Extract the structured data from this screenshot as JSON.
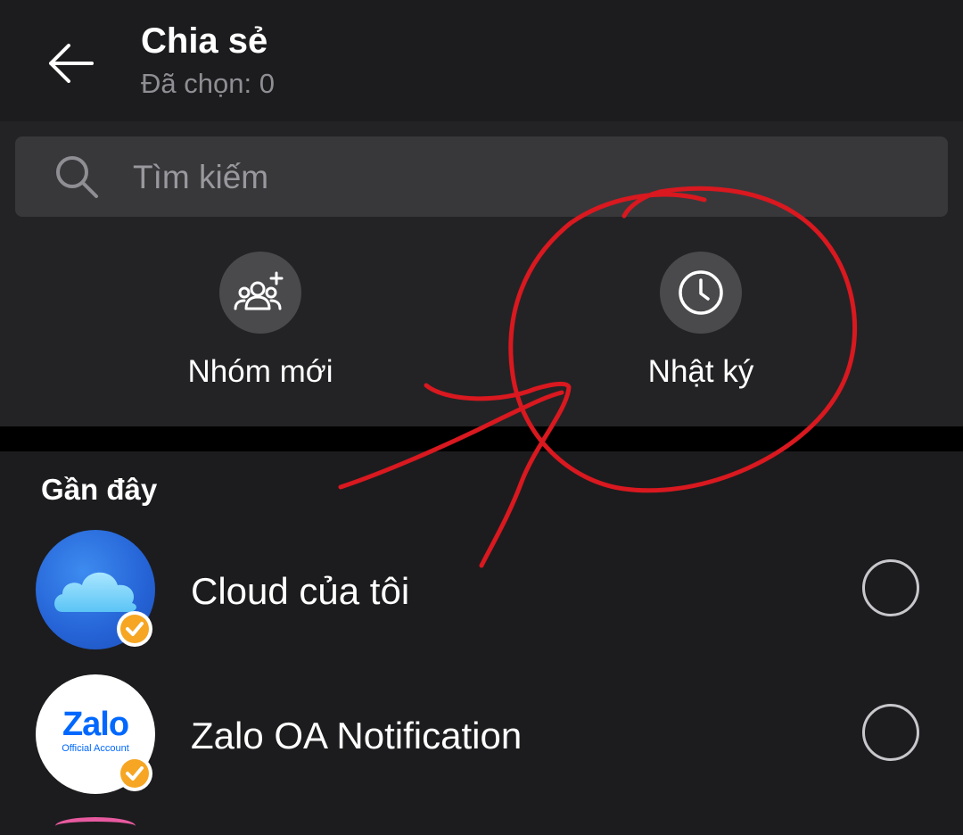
{
  "header": {
    "title": "Chia sẻ",
    "subtitle": "Đã chọn: 0",
    "back_icon": "arrow-left-icon"
  },
  "search": {
    "placeholder": "Tìm kiếm",
    "icon": "search-icon"
  },
  "actions": [
    {
      "label": "Nhóm mới",
      "icon": "group-add-icon"
    },
    {
      "label": "Nhật ký",
      "icon": "clock-icon"
    }
  ],
  "recent": {
    "title": "Gần đây",
    "items": [
      {
        "name": "Cloud của tôi",
        "avatar": "cloud-icon",
        "verified": true,
        "selected": false
      },
      {
        "name": "Zalo OA Notification",
        "avatar": "zalo-logo",
        "logo_text": "Zalo",
        "logo_subtext": "Official Account",
        "verified": true,
        "selected": false
      }
    ]
  },
  "colors": {
    "background": "#1c1c1e",
    "search_bg": "#38383b",
    "action_circle": "#4a4a4d",
    "badge": "#f6a623",
    "zalo_blue": "#0068ff",
    "annotation_red": "#d9181f"
  }
}
